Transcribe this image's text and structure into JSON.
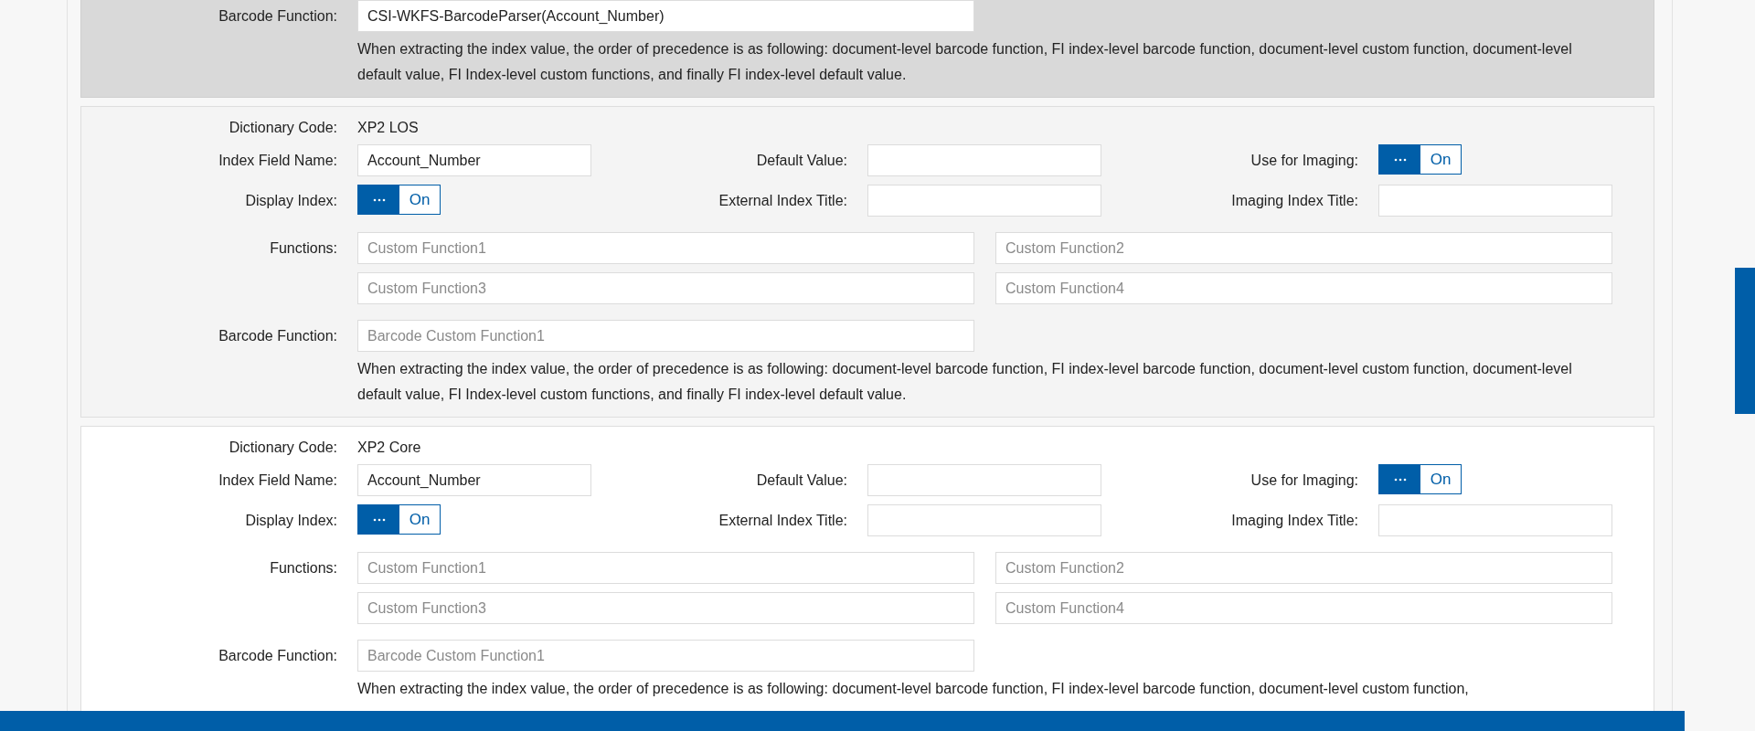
{
  "cards": [
    {
      "kind": "selected",
      "barcode_label": "Barcode Function:",
      "barcode_value": "CSI-WKFS-BarcodeParser(Account_Number)",
      "note": "When extracting the index value, the order of precedence is as following: document-level barcode function, FI index-level barcode function, document-level custom function, document-level default value, FI Index-level custom functions, and finally FI index-level default value."
    },
    {
      "kind": "shaded",
      "dictionary_label": "Dictionary Code:",
      "dictionary_value": "XP2 LOS",
      "index_label": "Index Field Name:",
      "index_value": "Account_Number",
      "default_label": "Default Value:",
      "imaging_label": "Use for Imaging:",
      "imaging_toggle": {
        "on": true,
        "label": "On"
      },
      "display_label": "Display Index:",
      "display_toggle": {
        "on": true,
        "label": "On"
      },
      "external_label": "External Index Title:",
      "imaging_title_label": "Imaging Index Title:",
      "functions_label": "Functions:",
      "functions": [
        {
          "placeholder": "Custom Function1"
        },
        {
          "placeholder": "Custom Function2"
        },
        {
          "placeholder": "Custom Function3"
        },
        {
          "placeholder": "Custom Function4"
        }
      ],
      "barcode_label": "Barcode Function:",
      "barcode_placeholder": "Barcode Custom Function1",
      "note": "When extracting the index value, the order of precedence is as following: document-level barcode function, FI index-level barcode function, document-level custom function, document-level default value, FI Index-level custom functions, and finally FI index-level default value."
    },
    {
      "kind": "plain",
      "dictionary_label": "Dictionary Code:",
      "dictionary_value": "XP2 Core",
      "index_label": "Index Field Name:",
      "index_value": "Account_Number",
      "default_label": "Default Value:",
      "imaging_label": "Use for Imaging:",
      "imaging_toggle": {
        "on": true,
        "label": "On"
      },
      "display_label": "Display Index:",
      "display_toggle": {
        "on": true,
        "label": "On"
      },
      "external_label": "External Index Title:",
      "imaging_title_label": "Imaging Index Title:",
      "functions_label": "Functions:",
      "functions": [
        {
          "placeholder": "Custom Function1"
        },
        {
          "placeholder": "Custom Function2"
        },
        {
          "placeholder": "Custom Function3"
        },
        {
          "placeholder": "Custom Function4"
        }
      ],
      "barcode_label": "Barcode Function:",
      "barcode_placeholder": "Barcode Custom Function1",
      "note": "When extracting the index value, the order of precedence is as following: document-level barcode function, FI index-level barcode function, document-level custom function,"
    }
  ]
}
